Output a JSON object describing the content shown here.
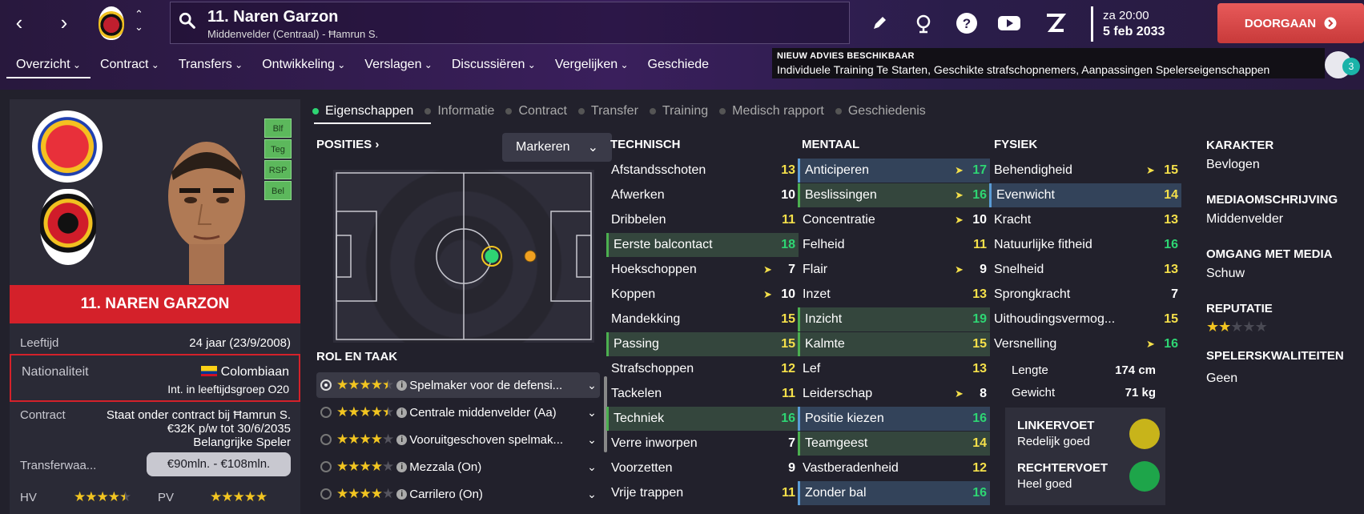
{
  "header": {
    "player_title": "11. Naren Garzon",
    "player_subtitle": "Middenvelder (Centraal) - Ħamrun S.",
    "date_line1": "za 20:00",
    "date_line2": "5 feb 2033",
    "continue_label": "DOORGAAN",
    "accent": "#d4212a"
  },
  "menu": [
    "Overzicht",
    "Contract",
    "Transfers",
    "Ontwikkeling",
    "Verslagen",
    "Discussiëren",
    "Vergelijken",
    "Geschiede"
  ],
  "advies": {
    "heading": "NIEUW ADVIES BESCHIKBAAR",
    "text": "Individuele Training Te Starten, Geschikte strafschopnemers, Aanpassingen Spelerseigenschappen",
    "badge_count": "3"
  },
  "profile": {
    "role_badges": [
      "Blf",
      "Teg",
      "RSP",
      "Bel"
    ],
    "name_banner": "11. NAREN GARZON",
    "age_label": "Leeftijd",
    "age_value": "24 jaar (23/9/2008)",
    "nat_label": "Nationaliteit",
    "nat_value": "Colombiaan",
    "nat_sub": "Int. in leeftijdsgroep O20",
    "contract_label": "Contract",
    "contract_line1": "Staat onder contract bij Ħamrun S.",
    "contract_line2": "€32K p/w tot 30/6/2035",
    "contract_line3": "Belangrijke Speler",
    "transfer_label": "Transferwaa...",
    "transfer_value": "€90mln. - €108mln.",
    "hv_label": "HV",
    "hv_stars": 4.5,
    "pv_label": "PV",
    "pv_stars": 5
  },
  "tabs": [
    "Eigenschappen",
    "Informatie",
    "Contract",
    "Transfer",
    "Training",
    "Medisch rapport",
    "Geschiedenis"
  ],
  "positions": {
    "heading": "POSITIES",
    "mark_button": "Markeren"
  },
  "roles": {
    "heading": "ROL EN TAAK",
    "items": [
      {
        "label": "Spelmaker voor de defensi...",
        "stars": 4.5,
        "selected": true
      },
      {
        "label": "Centrale middenvelder (Aa)",
        "stars": 4.5,
        "selected": false
      },
      {
        "label": "Vooruitgeschoven spelmak...",
        "stars": 4,
        "selected": false
      },
      {
        "label": "Mezzala (On)",
        "stars": 4,
        "selected": false
      },
      {
        "label": "Carrilero (On)",
        "stars": 4,
        "selected": false
      }
    ]
  },
  "technisch": {
    "heading": "TECHNISCH",
    "items": [
      {
        "name": "Afstandsschoten",
        "value": "13",
        "rising": false,
        "hl": "",
        "color": "#f5e04a"
      },
      {
        "name": "Afwerken",
        "value": "10",
        "rising": false,
        "hl": "",
        "color": "#ffffff"
      },
      {
        "name": "Dribbelen",
        "value": "11",
        "rising": false,
        "hl": "",
        "color": "#f5e04a"
      },
      {
        "name": "Eerste balcontact",
        "value": "18",
        "rising": false,
        "hl": "green",
        "color": "#2ed573"
      },
      {
        "name": "Hoekschoppen",
        "value": "7",
        "rising": true,
        "hl": "",
        "color": "#ffffff"
      },
      {
        "name": "Koppen",
        "value": "10",
        "rising": true,
        "hl": "",
        "color": "#ffffff"
      },
      {
        "name": "Mandekking",
        "value": "15",
        "rising": false,
        "hl": "",
        "color": "#f5e04a"
      },
      {
        "name": "Passing",
        "value": "15",
        "rising": false,
        "hl": "green",
        "color": "#f5e04a"
      },
      {
        "name": "Strafschoppen",
        "value": "12",
        "rising": false,
        "hl": "",
        "color": "#f5e04a"
      },
      {
        "name": "Tackelen",
        "value": "11",
        "rising": false,
        "hl": "",
        "color": "#f5e04a"
      },
      {
        "name": "Techniek",
        "value": "16",
        "rising": false,
        "hl": "green",
        "color": "#2ed573"
      },
      {
        "name": "Verre inworpen",
        "value": "7",
        "rising": false,
        "hl": "",
        "color": "#ffffff"
      },
      {
        "name": "Voorzetten",
        "value": "9",
        "rising": false,
        "hl": "",
        "color": "#ffffff"
      },
      {
        "name": "Vrije trappen",
        "value": "11",
        "rising": false,
        "hl": "",
        "color": "#f5e04a"
      }
    ]
  },
  "mentaal": {
    "heading": "MENTAAL",
    "items": [
      {
        "name": "Anticiperen",
        "value": "17",
        "rising": true,
        "hl": "blue",
        "color": "#2ed573"
      },
      {
        "name": "Beslissingen",
        "value": "16",
        "rising": true,
        "hl": "green",
        "color": "#2ed573"
      },
      {
        "name": "Concentratie",
        "value": "10",
        "rising": true,
        "hl": "",
        "color": "#ffffff"
      },
      {
        "name": "Felheid",
        "value": "11",
        "rising": false,
        "hl": "",
        "color": "#f5e04a"
      },
      {
        "name": "Flair",
        "value": "9",
        "rising": true,
        "hl": "",
        "color": "#ffffff"
      },
      {
        "name": "Inzet",
        "value": "13",
        "rising": false,
        "hl": "",
        "color": "#f5e04a"
      },
      {
        "name": "Inzicht",
        "value": "19",
        "rising": false,
        "hl": "green",
        "color": "#2ed573"
      },
      {
        "name": "Kalmte",
        "value": "15",
        "rising": false,
        "hl": "green",
        "color": "#f5e04a"
      },
      {
        "name": "Lef",
        "value": "13",
        "rising": false,
        "hl": "",
        "color": "#f5e04a"
      },
      {
        "name": "Leiderschap",
        "value": "8",
        "rising": true,
        "hl": "",
        "color": "#ffffff"
      },
      {
        "name": "Positie kiezen",
        "value": "16",
        "rising": false,
        "hl": "blue",
        "color": "#2ed573"
      },
      {
        "name": "Teamgeest",
        "value": "14",
        "rising": false,
        "hl": "green",
        "color": "#f5e04a"
      },
      {
        "name": "Vastberadenheid",
        "value": "12",
        "rising": false,
        "hl": "",
        "color": "#f5e04a"
      },
      {
        "name": "Zonder bal",
        "value": "16",
        "rising": false,
        "hl": "blue",
        "color": "#2ed573"
      }
    ]
  },
  "fysiek": {
    "heading": "FYSIEK",
    "items": [
      {
        "name": "Behendigheid",
        "value": "15",
        "rising": true,
        "hl": "",
        "color": "#f5e04a"
      },
      {
        "name": "Evenwicht",
        "value": "14",
        "rising": false,
        "hl": "blue",
        "color": "#f5e04a"
      },
      {
        "name": "Kracht",
        "value": "13",
        "rising": false,
        "hl": "",
        "color": "#f5e04a"
      },
      {
        "name": "Natuurlijke fitheid",
        "value": "16",
        "rising": false,
        "hl": "",
        "color": "#2ed573"
      },
      {
        "name": "Snelheid",
        "value": "13",
        "rising": false,
        "hl": "",
        "color": "#f5e04a"
      },
      {
        "name": "Sprongkracht",
        "value": "7",
        "rising": false,
        "hl": "",
        "color": "#ffffff"
      },
      {
        "name": "Uithoudingsvermog...",
        "value": "15",
        "rising": false,
        "hl": "",
        "color": "#f5e04a"
      },
      {
        "name": "Versnelling",
        "value": "16",
        "rising": true,
        "hl": "",
        "color": "#2ed573"
      }
    ],
    "length_label": "Lengte",
    "length_value": "174 cm",
    "weight_label": "Gewicht",
    "weight_value": "71 kg",
    "left_foot_label": "LINKERVOET",
    "left_foot_value": "Redelijk goed",
    "right_foot_label": "RECHTERVOET",
    "right_foot_value": "Heel goed"
  },
  "sidebar_right": {
    "karakter_h": "KARAKTER",
    "karakter_v": "Bevlogen",
    "media_h": "MEDIAOMSCHRIJVING",
    "media_v": "Middenvelder",
    "omgang_h": "OMGANG MET MEDIA",
    "omgang_v": "Schuw",
    "rep_h": "REPUTATIE",
    "rep_stars": 2,
    "kwal_h": "SPELERSKWALITEITEN",
    "kwal_v": "Geen"
  }
}
